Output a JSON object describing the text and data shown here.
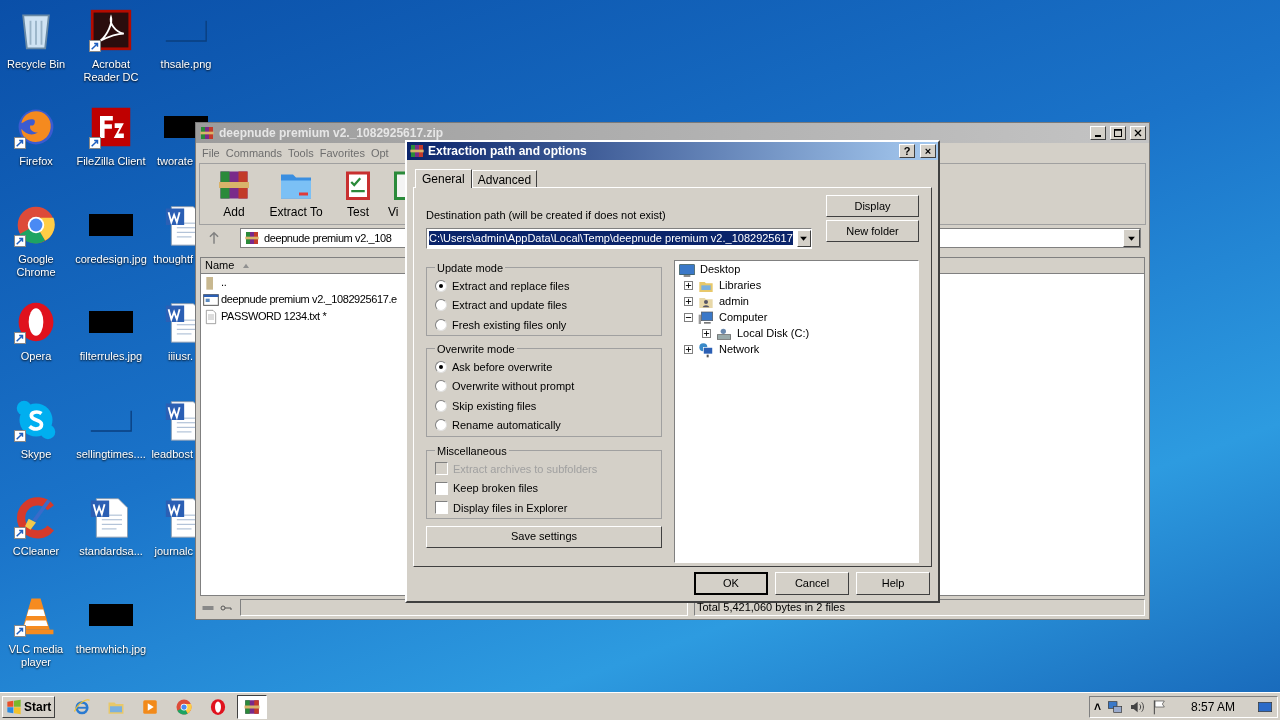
{
  "desktop": {
    "columns": [
      [
        {
          "label": "Recycle Bin",
          "kind": "recycle",
          "shortcut": false
        },
        {
          "label": "Firefox",
          "kind": "firefox",
          "shortcut": true
        },
        {
          "label": "Google Chrome",
          "kind": "chrome",
          "shortcut": true
        },
        {
          "label": "Opera",
          "kind": "opera",
          "shortcut": true
        },
        {
          "label": "Skype",
          "kind": "skype",
          "shortcut": true
        },
        {
          "label": "CCleaner",
          "kind": "ccleaner",
          "shortcut": true
        },
        {
          "label": "VLC media player",
          "kind": "vlc",
          "shortcut": true
        }
      ],
      [
        {
          "label": "Acrobat Reader DC",
          "kind": "acrobat",
          "shortcut": true
        },
        {
          "label": "FileZilla Client",
          "kind": "filezilla",
          "shortcut": true
        },
        {
          "label": "coredesign.jpg",
          "kind": "redacted",
          "shortcut": false
        },
        {
          "label": "filterrules.jpg",
          "kind": "redacted",
          "shortcut": false
        },
        {
          "label": "sellingtimes....",
          "kind": "blank_image",
          "shortcut": false
        },
        {
          "label": "standardsa...",
          "kind": "word",
          "shortcut": false
        },
        {
          "label": "themwhich.jpg",
          "kind": "redacted",
          "shortcut": false
        }
      ],
      [
        {
          "label": "thsale.png",
          "kind": "blank_image",
          "shortcut": false
        },
        {
          "label": "tworate",
          "kind": "redacted",
          "shortcut": false
        },
        {
          "label": "thoughtf",
          "kind": "word",
          "shortcut": false
        },
        {
          "label": "iiiusr.",
          "kind": "word",
          "shortcut": false
        },
        {
          "label": "leadbost",
          "kind": "word",
          "shortcut": false
        },
        {
          "label": "journalc",
          "kind": "word",
          "shortcut": false
        }
      ]
    ]
  },
  "archive_window": {
    "title": "deepnude premium v2._1082925617.zip",
    "menu": [
      "File",
      "Commands",
      "Tools",
      "Favorites",
      "Opt"
    ],
    "toolbar": [
      {
        "label": "Add",
        "kind": "add"
      },
      {
        "label": "Extract To",
        "kind": "extract"
      },
      {
        "label": "Test",
        "kind": "test"
      },
      {
        "label": "Vi",
        "kind": "view"
      }
    ],
    "address": "deepnude premium v2._108",
    "list": {
      "column": "Name",
      "rows": [
        {
          "name": "..",
          "kind": "up"
        },
        {
          "name": "deepnude premium v2._1082925617.e",
          "kind": "exe"
        },
        {
          "name": "PASSWORD 1234.txt *",
          "kind": "text"
        }
      ]
    },
    "status": "Total 5,421,060 bytes in 2 files"
  },
  "dialog": {
    "title": "Extraction path and options",
    "title_buttons": [
      "?",
      "×"
    ],
    "tabs": [
      {
        "label": "General",
        "selected": true
      },
      {
        "label": "Advanced",
        "selected": false
      }
    ],
    "destination_label": "Destination path (will be created if does not exist)",
    "destination_path": "C:\\Users\\admin\\AppData\\Local\\Temp\\deepnude premium v2._1082925617",
    "side_buttons": [
      "Display",
      "New folder"
    ],
    "update_mode": {
      "legend": "Update mode",
      "options": [
        {
          "label": "Extract and replace files",
          "selected": true
        },
        {
          "label": "Extract and update files",
          "selected": false
        },
        {
          "label": "Fresh existing files only",
          "selected": false
        }
      ]
    },
    "overwrite_mode": {
      "legend": "Overwrite mode",
      "options": [
        {
          "label": "Ask before overwrite",
          "selected": true
        },
        {
          "label": "Overwrite without prompt",
          "selected": false
        },
        {
          "label": "Skip existing files",
          "selected": false
        },
        {
          "label": "Rename automatically",
          "selected": false
        }
      ]
    },
    "miscellaneous": {
      "legend": "Miscellaneous",
      "options": [
        {
          "label": "Extract archives to subfolders",
          "checked": false,
          "disabled": true
        },
        {
          "label": "Keep broken files",
          "checked": false,
          "disabled": false
        },
        {
          "label": "Display files in Explorer",
          "checked": false,
          "disabled": false
        }
      ]
    },
    "save_button": "Save settings",
    "tree": [
      {
        "label": "Desktop",
        "kind": "desktop",
        "children": [
          {
            "label": "Libraries",
            "kind": "library",
            "expanded": false
          },
          {
            "label": "admin",
            "kind": "user",
            "expanded": false
          },
          {
            "label": "Computer",
            "kind": "computer",
            "expanded": true,
            "children": [
              {
                "label": "Local Disk (C:)",
                "kind": "drive",
                "expanded": false
              }
            ]
          },
          {
            "label": "Network",
            "kind": "network",
            "expanded": false
          }
        ]
      }
    ],
    "buttons": [
      {
        "label": "OK",
        "default": true
      },
      {
        "label": "Cancel",
        "default": false
      },
      {
        "label": "Help",
        "default": false
      }
    ]
  },
  "taskbar": {
    "start": "Start",
    "apps": [
      {
        "kind": "ie",
        "active": false
      },
      {
        "kind": "explorer",
        "active": false
      },
      {
        "kind": "media",
        "active": false
      },
      {
        "kind": "chrome",
        "active": false
      },
      {
        "kind": "opera",
        "active": false
      },
      {
        "kind": "winrar",
        "active": true
      }
    ],
    "tray_toggle": "˄",
    "clock": "8:57 AM"
  }
}
